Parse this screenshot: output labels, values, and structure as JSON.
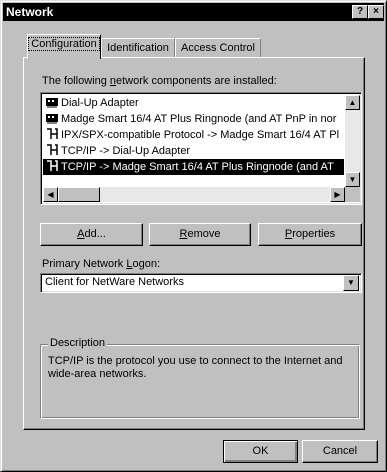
{
  "window": {
    "title": "Network",
    "help_label": "?",
    "close_label": "×"
  },
  "tabs": [
    {
      "label": "Configuration",
      "active": true
    },
    {
      "label": "Identification",
      "active": false
    },
    {
      "label": "Access Control",
      "active": false
    }
  ],
  "components": {
    "label_prefix": "The following ",
    "label_accel": "n",
    "label_suffix": "etwork components are installed:",
    "items": [
      {
        "icon": "network-adapter-icon",
        "label": "Dial-Up Adapter",
        "selected": false
      },
      {
        "icon": "network-adapter-icon",
        "label": "Madge Smart 16/4 AT Plus Ringnode (and AT PnP in nor",
        "selected": false
      },
      {
        "icon": "protocol-icon",
        "label": "IPX/SPX-compatible Protocol -> Madge Smart 16/4 AT Pl",
        "selected": false
      },
      {
        "icon": "protocol-icon",
        "label": "TCP/IP -> Dial-Up Adapter",
        "selected": false
      },
      {
        "icon": "protocol-icon",
        "label": "TCP/IP -> Madge Smart 16/4 AT Plus Ringnode (and AT",
        "selected": true
      }
    ]
  },
  "buttons": {
    "add_accel": "A",
    "add_rest": "dd...",
    "remove_accel": "R",
    "remove_rest": "emove",
    "properties_accel": "P",
    "properties_rest": "roperties",
    "ok": "OK",
    "cancel": "Cancel"
  },
  "logon": {
    "label_prefix": "Primary Network ",
    "label_accel": "L",
    "label_suffix": "ogon:",
    "value": "Client for NetWare Networks"
  },
  "description": {
    "title": "Description",
    "text": "TCP/IP is the protocol you use to connect to the Internet and wide-area networks."
  },
  "colors": {
    "face": "#c0c0c0",
    "selection": "#000000",
    "titlebar": "#000000"
  }
}
